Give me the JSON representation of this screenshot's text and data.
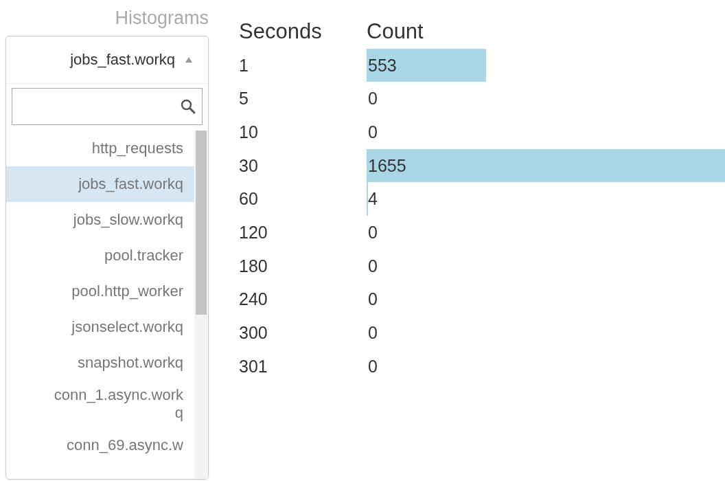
{
  "sidebar": {
    "heading": "Histograms",
    "dropdown": {
      "value": "jobs_fast.workq",
      "expanded": true,
      "items": [
        {
          "label": "http_requests",
          "selected": false
        },
        {
          "label": "jobs_fast.workq",
          "selected": true
        },
        {
          "label": "jobs_slow.workq",
          "selected": false
        },
        {
          "label": "pool.tracker",
          "selected": false
        },
        {
          "label": "pool.http_worker",
          "selected": false
        },
        {
          "label": "jsonselect.workq",
          "selected": false
        },
        {
          "label": "snapshot.workq",
          "selected": false
        },
        {
          "label": "conn_1.async.workq",
          "selected": false
        },
        {
          "label": "conn_69.async.w",
          "selected": false
        }
      ]
    }
  },
  "table": {
    "columns": [
      "Seconds",
      "Count"
    ],
    "rows": [
      {
        "seconds": "1",
        "count": "553"
      },
      {
        "seconds": "5",
        "count": "0"
      },
      {
        "seconds": "10",
        "count": "0"
      },
      {
        "seconds": "30",
        "count": "1655"
      },
      {
        "seconds": "60",
        "count": "4"
      },
      {
        "seconds": "120",
        "count": "0"
      },
      {
        "seconds": "180",
        "count": "0"
      },
      {
        "seconds": "240",
        "count": "0"
      },
      {
        "seconds": "300",
        "count": "0"
      },
      {
        "seconds": "301",
        "count": "0"
      }
    ]
  }
}
